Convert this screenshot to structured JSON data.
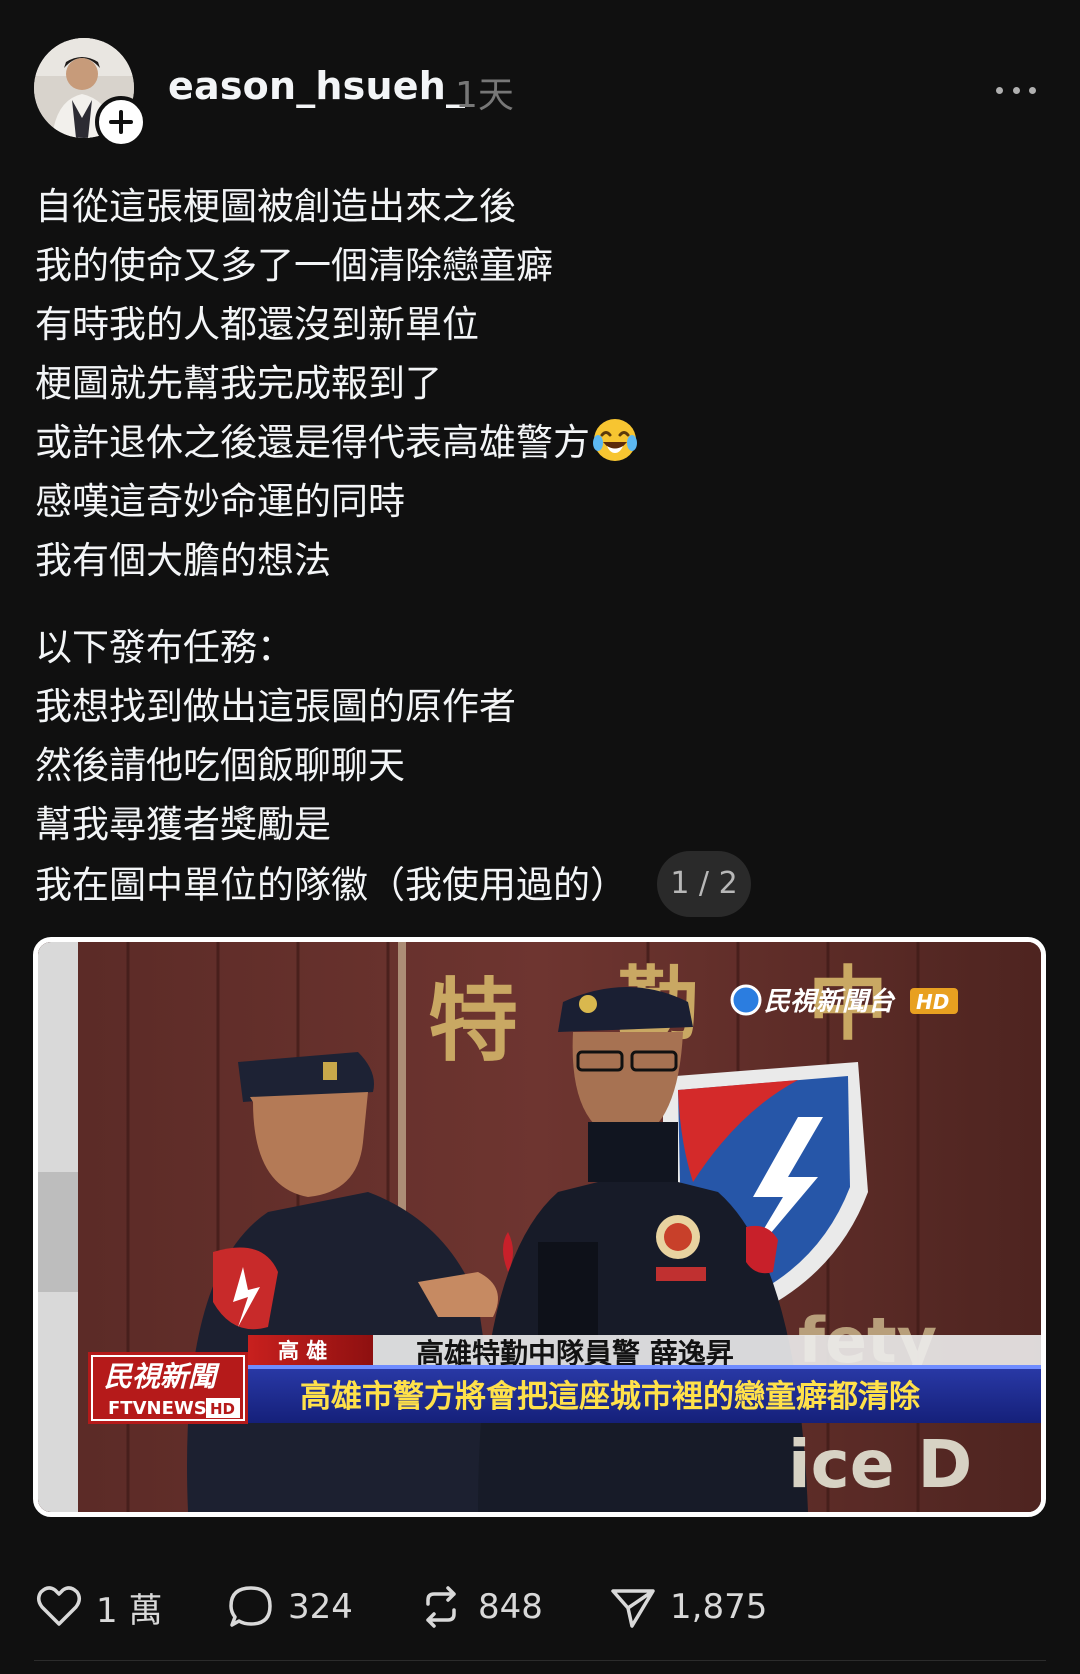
{
  "post": {
    "username": "eason_hsueh_",
    "timestamp": "1天",
    "text_block1": [
      "自從這張梗圖被創造出來之後",
      "我的使命又多了一個清除戀童癖",
      "有時我的人都還沒到新單位",
      "梗圖就先幫我完成報到了",
      "或許退休之後還是得代表高雄警方",
      "感嘆這奇妙命運的同時",
      "我有個大膽的想法"
    ],
    "text_block2": [
      "以下發布任務：",
      "我想找到做出這張圖的原作者",
      "然後請他吃個飯聊聊天",
      "幫我尋獲者獎勵是",
      "我在圖中單位的隊徽（我使用過的）"
    ],
    "media_counter": "1 / 2"
  },
  "media": {
    "channel_logo_text": "民視新聞台",
    "channel_logo_badge": "HD",
    "wall_char_1": "特",
    "wall_char_2": "勤",
    "wall_char_3": "中",
    "location_tag": "高 雄",
    "name_caption": "高雄特勤中隊員警 薛逸昇",
    "brand_main": "民視新聞",
    "brand_sub": "FTVNEWS",
    "brand_badge": "HD",
    "headline": "高雄市警方將會把這座城市裡的戀童癖都清除"
  },
  "actions": {
    "likes": "1 萬",
    "comments": "324",
    "reposts": "848",
    "shares": "1,875"
  },
  "colors": {
    "background": "#101010",
    "text": "#f3f5f7",
    "muted": "#777777",
    "banner_blue": "#1d2a8a",
    "banner_red": "#b51a1a"
  },
  "icons": {
    "more": "more-horizontal-icon",
    "follow": "plus-icon",
    "like": "heart-icon",
    "comment": "speech-bubble-icon",
    "repost": "repost-arrows-icon",
    "share": "paper-plane-icon"
  }
}
